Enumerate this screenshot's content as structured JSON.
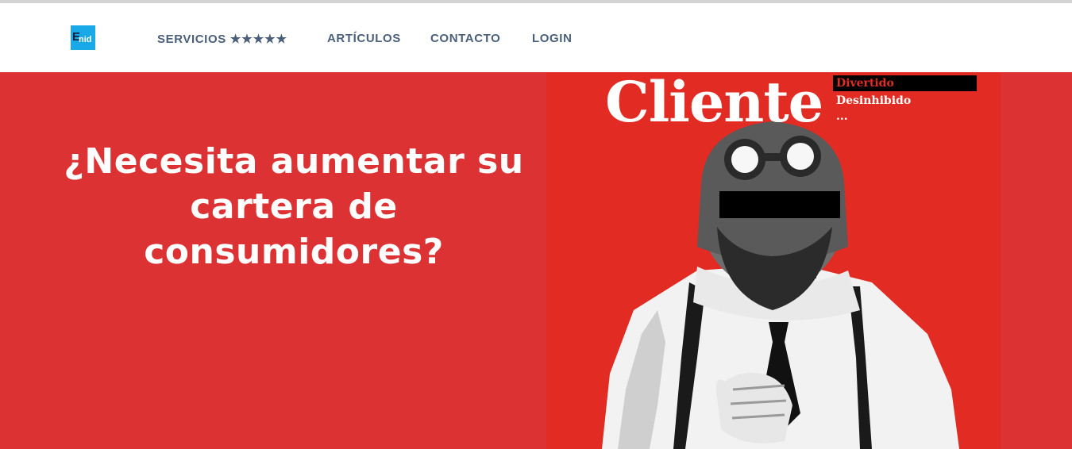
{
  "brand": {
    "logo_e": "E",
    "logo_nid": "nid",
    "logo_color": "#1aa9e8"
  },
  "nav": {
    "servicios": "SERVICIOS",
    "servicios_stars": "★★★★★",
    "articulos": "ARTÍCULOS",
    "contacto": "CONTACTO",
    "login": "LOGIN",
    "text_color": "#4a5f7a"
  },
  "hero": {
    "headline_line1": "¿Necesita aumentar su",
    "headline_line2": "cartera de consumidores?",
    "background": "#dc3233"
  },
  "poster": {
    "title": "Cliente",
    "tags": [
      "Divertido",
      "Desinhibido",
      "..."
    ],
    "background": "#e22b22"
  }
}
